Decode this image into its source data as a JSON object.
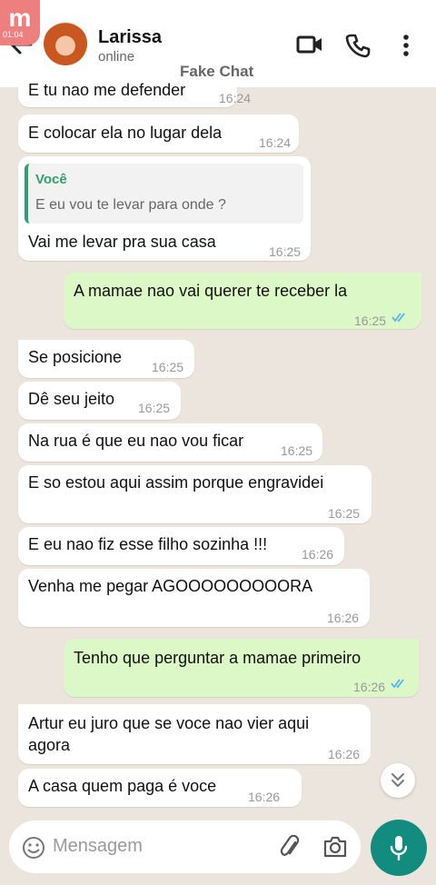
{
  "app": {
    "watermark": "Fake Chat"
  },
  "overlay": {
    "logo_letter": "m",
    "timer": "01:04"
  },
  "contact": {
    "name": "Larissa",
    "status": "online"
  },
  "colors": {
    "incoming": "#ffffff",
    "outgoing": "#dcf8c6",
    "accent": "#128c7e",
    "reply_bar": "#2f9e72"
  },
  "messages": [
    {
      "text": "E tu nao me defender",
      "time": "16:24",
      "dir": "in"
    },
    {
      "text": "E colocar ela no lugar dela",
      "time": "16:24",
      "dir": "in"
    },
    {
      "text": "Vai me levar pra sua casa",
      "time": "16:25",
      "dir": "in",
      "reply_author": "Você",
      "reply_text": "E eu vou te levar para onde ?"
    },
    {
      "text": "A mamae nao vai querer te receber la",
      "time": "16:25",
      "dir": "out",
      "status": "read"
    },
    {
      "text": "Se posicione",
      "time": "16:25",
      "dir": "in"
    },
    {
      "text": "Dê seu jeito",
      "time": "16:25",
      "dir": "in"
    },
    {
      "text": "Na rua é que eu nao vou ficar",
      "time": "16:25",
      "dir": "in"
    },
    {
      "text": "E so estou aqui assim porque engravidei",
      "time": "16:25",
      "dir": "in"
    },
    {
      "text": "E eu nao fiz esse filho sozinha !!!",
      "time": "16:26",
      "dir": "in"
    },
    {
      "text": "Venha me pegar AGOOOOOOOOORA",
      "time": "16:26",
      "dir": "in"
    },
    {
      "text": "Tenho que perguntar a mamae primeiro",
      "time": "16:26",
      "dir": "out",
      "status": "read"
    },
    {
      "text": "Artur eu juro que se voce nao vier aqui",
      "text2": "agora",
      "time": "16:26",
      "dir": "in"
    },
    {
      "text": "A casa quem paga é voce",
      "time": "16:26",
      "dir": "in"
    }
  ],
  "composer": {
    "placeholder": "Mensagem"
  },
  "icons": {
    "back": "arrow-left-icon",
    "video": "video-call-icon",
    "call": "phone-icon",
    "menu": "more-vert-icon",
    "emoji": "emoji-icon",
    "attach": "paperclip-icon",
    "camera": "camera-icon",
    "mic": "microphone-icon",
    "scroll": "double-chevron-down-icon",
    "read": "double-check-icon"
  }
}
